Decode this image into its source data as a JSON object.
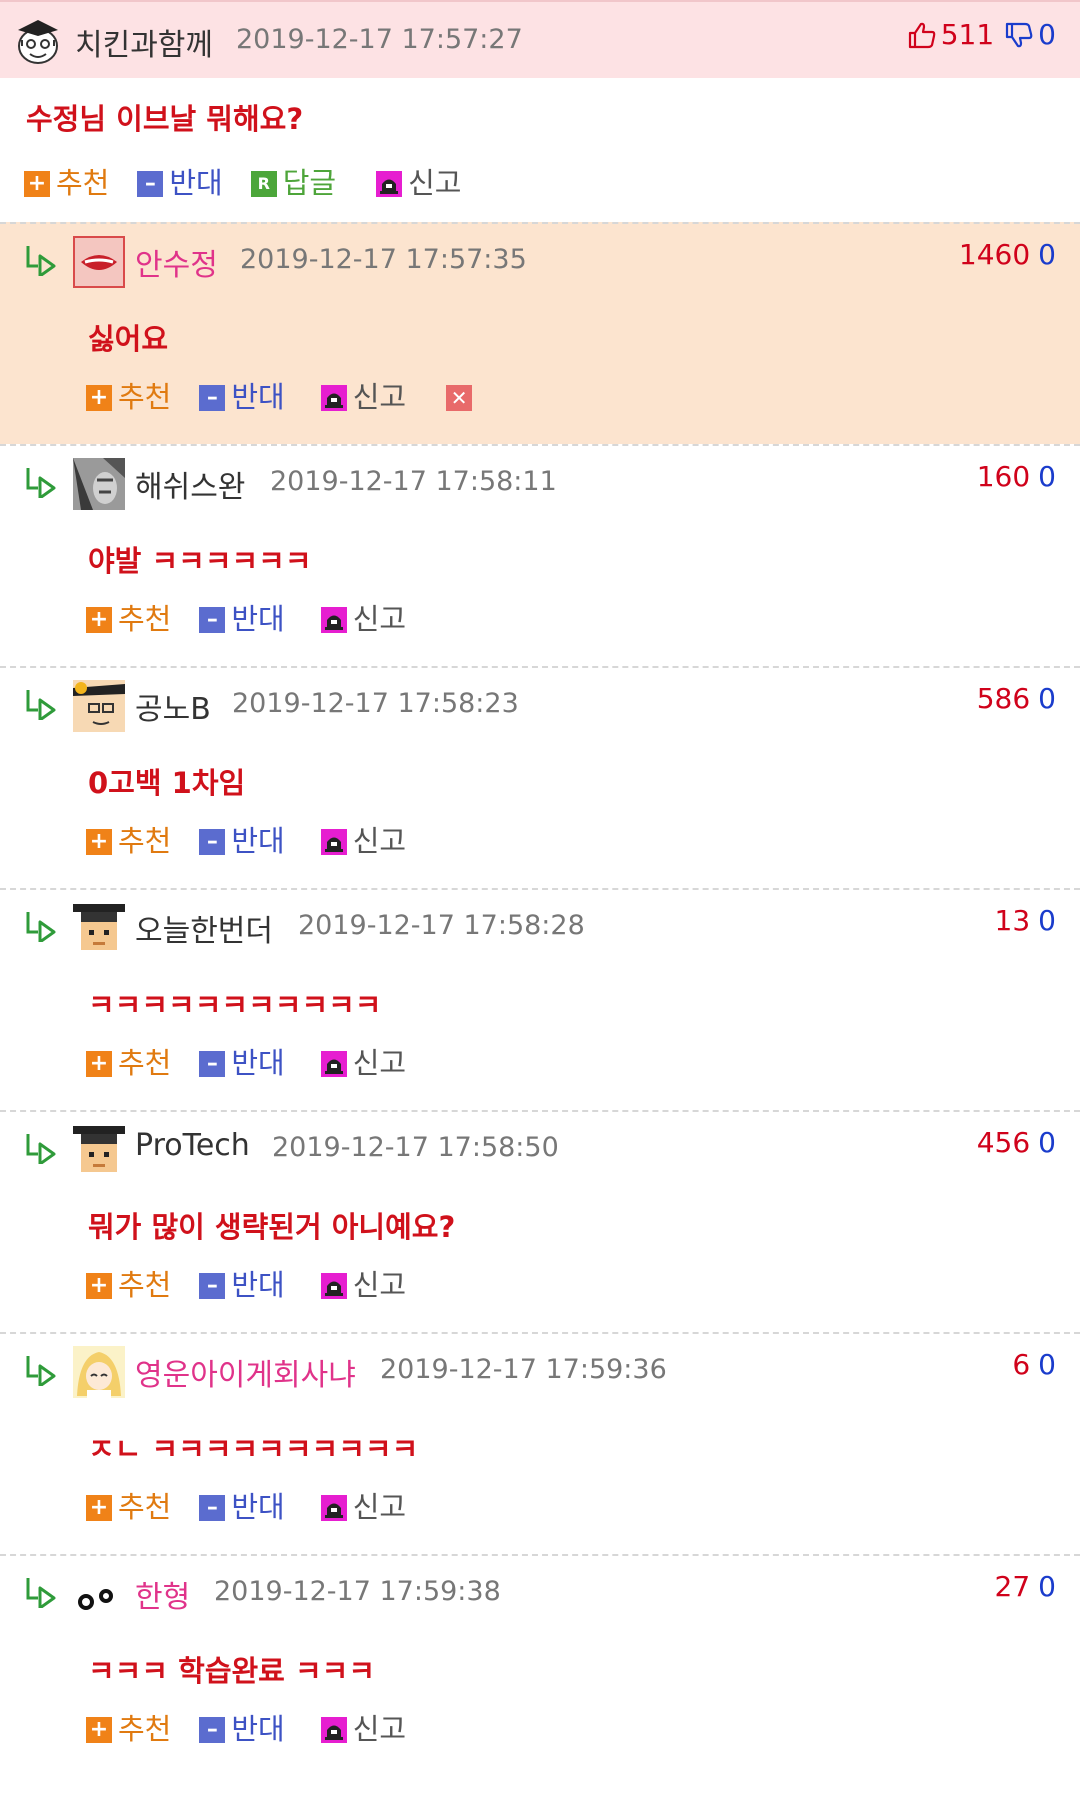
{
  "post": {
    "author": "치킨과함께",
    "date": "2019-12-17 17:57:27",
    "up_votes": "511",
    "down_votes": "0",
    "title": "수정님 이브날 뭐해요?",
    "actions": {
      "recommend": "추천",
      "oppose": "반대",
      "reply": "답글",
      "report": "신고"
    }
  },
  "action_labels": {
    "recommend": "추천",
    "oppose": "반대",
    "report": "신고"
  },
  "colors": {
    "header_bg": "#fde2e4",
    "highlight_bg": "#fce4cf",
    "title_red": "#d0111b",
    "up_red": "#d0021b",
    "down_blue": "#1a3ccc"
  },
  "comments": [
    {
      "author": "안수정",
      "author_color": "#e0338a",
      "date": "2019-12-17 17:57:35",
      "up": "1460",
      "down": "0",
      "body": "싫어요",
      "highlight": true,
      "deletable": true,
      "avatar": "lips-avatar"
    },
    {
      "author": "해쉬스완",
      "author_color": "#333333",
      "date": "2019-12-17 17:58:11",
      "up": "160",
      "down": "0",
      "body": "야발 ㅋㅋㅋㅋㅋㅋ",
      "highlight": false,
      "avatar": "bw-photo-avatar"
    },
    {
      "author": "공노B",
      "author_color": "#333333",
      "date": "2019-12-17 17:58:23",
      "up": "586",
      "down": "0",
      "body": "0고백 1차임",
      "highlight": false,
      "avatar": "cartoon-face-avatar"
    },
    {
      "author": "오늘한번더",
      "author_color": "#333333",
      "date": "2019-12-17 17:58:28",
      "up": "13",
      "down": "0",
      "body": "ㅋㅋㅋㅋㅋㅋㅋㅋㅋㅋㅋ",
      "highlight": false,
      "avatar": "pixel-face-avatar"
    },
    {
      "author": "ProTech",
      "author_color": "#333333",
      "date": "2019-12-17 17:58:50",
      "up": "456",
      "down": "0",
      "body": "뭐가 많이 생략된거 아니예요?",
      "highlight": false,
      "avatar": "pixel-face-avatar"
    },
    {
      "author": "영운아이게회사냐",
      "author_color": "#e0338a",
      "date": "2019-12-17 17:59:36",
      "up": "6",
      "down": "0",
      "body": "ㅈㄴ ㅋㅋㅋㅋㅋㅋㅋㅋㅋㅋ",
      "highlight": false,
      "avatar": "anime-avatar"
    },
    {
      "author": "한형",
      "author_color": "#e0338a",
      "date": "2019-12-17 17:59:38",
      "up": "27",
      "down": "0",
      "body": "ㅋㅋㅋ 학습완료 ㅋㅋㅋ",
      "highlight": false,
      "avatar": "dots-avatar"
    }
  ]
}
